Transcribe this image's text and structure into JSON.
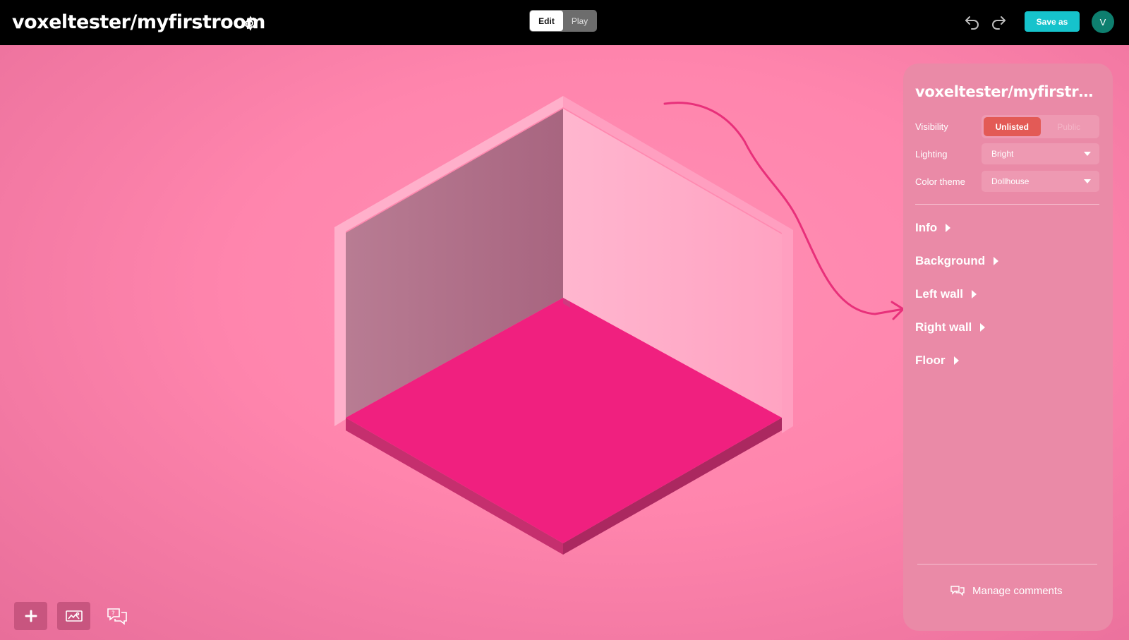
{
  "header": {
    "room_title": "voxeltester/myfirstroom",
    "mode_edit": "Edit",
    "mode_play": "Play",
    "save_as": "Save as",
    "avatar_initial": "V"
  },
  "panel": {
    "title": "voxeltester/myfirstroom",
    "visibility_label": "Visibility",
    "visibility_options": [
      "Unlisted",
      "Public"
    ],
    "lighting_label": "Lighting",
    "lighting_value": "Bright",
    "color_theme_label": "Color theme",
    "color_theme_value": "Dollhouse",
    "sections": [
      "Info",
      "Background",
      "Left wall",
      "Right wall",
      "Floor"
    ],
    "manage_comments": "Manage comments"
  },
  "colors": {
    "accent_save": "#16c3cc",
    "visibility_active": "#e35a56",
    "floor": "#f0207f",
    "left_wall": "#b5788f",
    "right_wall": "#ffa5c4",
    "arrow": "#e8307a"
  },
  "icons": [
    "gear-icon",
    "undo-icon",
    "redo-icon",
    "plus-icon",
    "gallery-icon",
    "help-chat-icon",
    "comments-icon"
  ]
}
